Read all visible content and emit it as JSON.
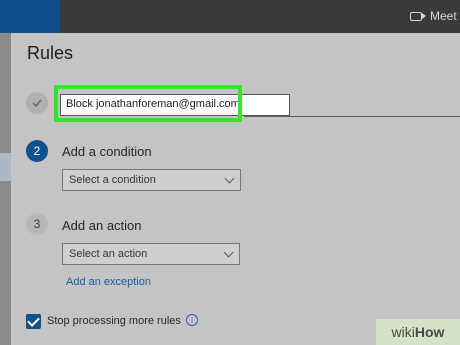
{
  "topbar": {
    "meet_label": "Meet",
    "meet_icon": "video-camera-icon"
  },
  "panel": {
    "title": "Rules",
    "step1": {
      "icon": "check-icon",
      "rule_name_value": "Block jonathanforeman@gmail.com"
    },
    "step2": {
      "number": "2",
      "label": "Add a condition",
      "dropdown_text": "Select a condition"
    },
    "step3": {
      "number": "3",
      "label": "Add an action",
      "dropdown_text": "Select an action"
    },
    "exception_link": "Add an exception",
    "stop_processing": {
      "label": "Stop processing more rules",
      "checked": true
    },
    "info_icon": "info-icon"
  },
  "watermark": {
    "prefix": "wiki",
    "suffix": "How"
  },
  "colors": {
    "accent": "#0f4f8c",
    "highlight": "#31e62c",
    "link": "#1f5aa0"
  }
}
